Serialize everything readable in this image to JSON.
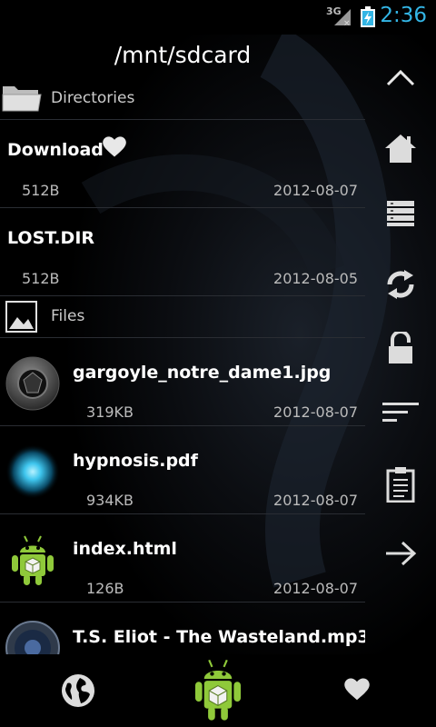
{
  "status_bar": {
    "network": "3G",
    "clock": "2:36",
    "clock_color": "#33b5e5"
  },
  "header": {
    "path": "/mnt/sdcard"
  },
  "sections": {
    "directories_label": "Directories",
    "files_label": "Files"
  },
  "directories": [
    {
      "name": "Download",
      "size": "512B",
      "date": "2012-08-07",
      "favorite": true
    },
    {
      "name": "LOST.DIR",
      "size": "512B",
      "date": "2012-08-05",
      "favorite": false
    }
  ],
  "files": [
    {
      "name": "gargoyle_notre_dame1.jpg",
      "size": "319KB",
      "date": "2012-08-07",
      "icon": "camera-aperture-icon"
    },
    {
      "name": "hypnosis.pdf",
      "size": "934KB",
      "date": "2012-08-07",
      "icon": "glowing-orb-icon"
    },
    {
      "name": "index.html",
      "size": "126B",
      "date": "2012-08-07",
      "icon": "android-robot-icon"
    },
    {
      "name": "T.S. Eliot - The Wasteland.mp3",
      "size": "",
      "date": "",
      "icon": "speaker-icon"
    }
  ],
  "side_toolbar": [
    "up-arrow-icon",
    "home-icon",
    "list-view-icon",
    "refresh-icon",
    "lock-icon",
    "sort-icon",
    "clipboard-icon",
    "forward-arrow-icon"
  ],
  "bottom_bar": [
    "globe-icon",
    "android-robot-icon",
    "heart-icon"
  ]
}
